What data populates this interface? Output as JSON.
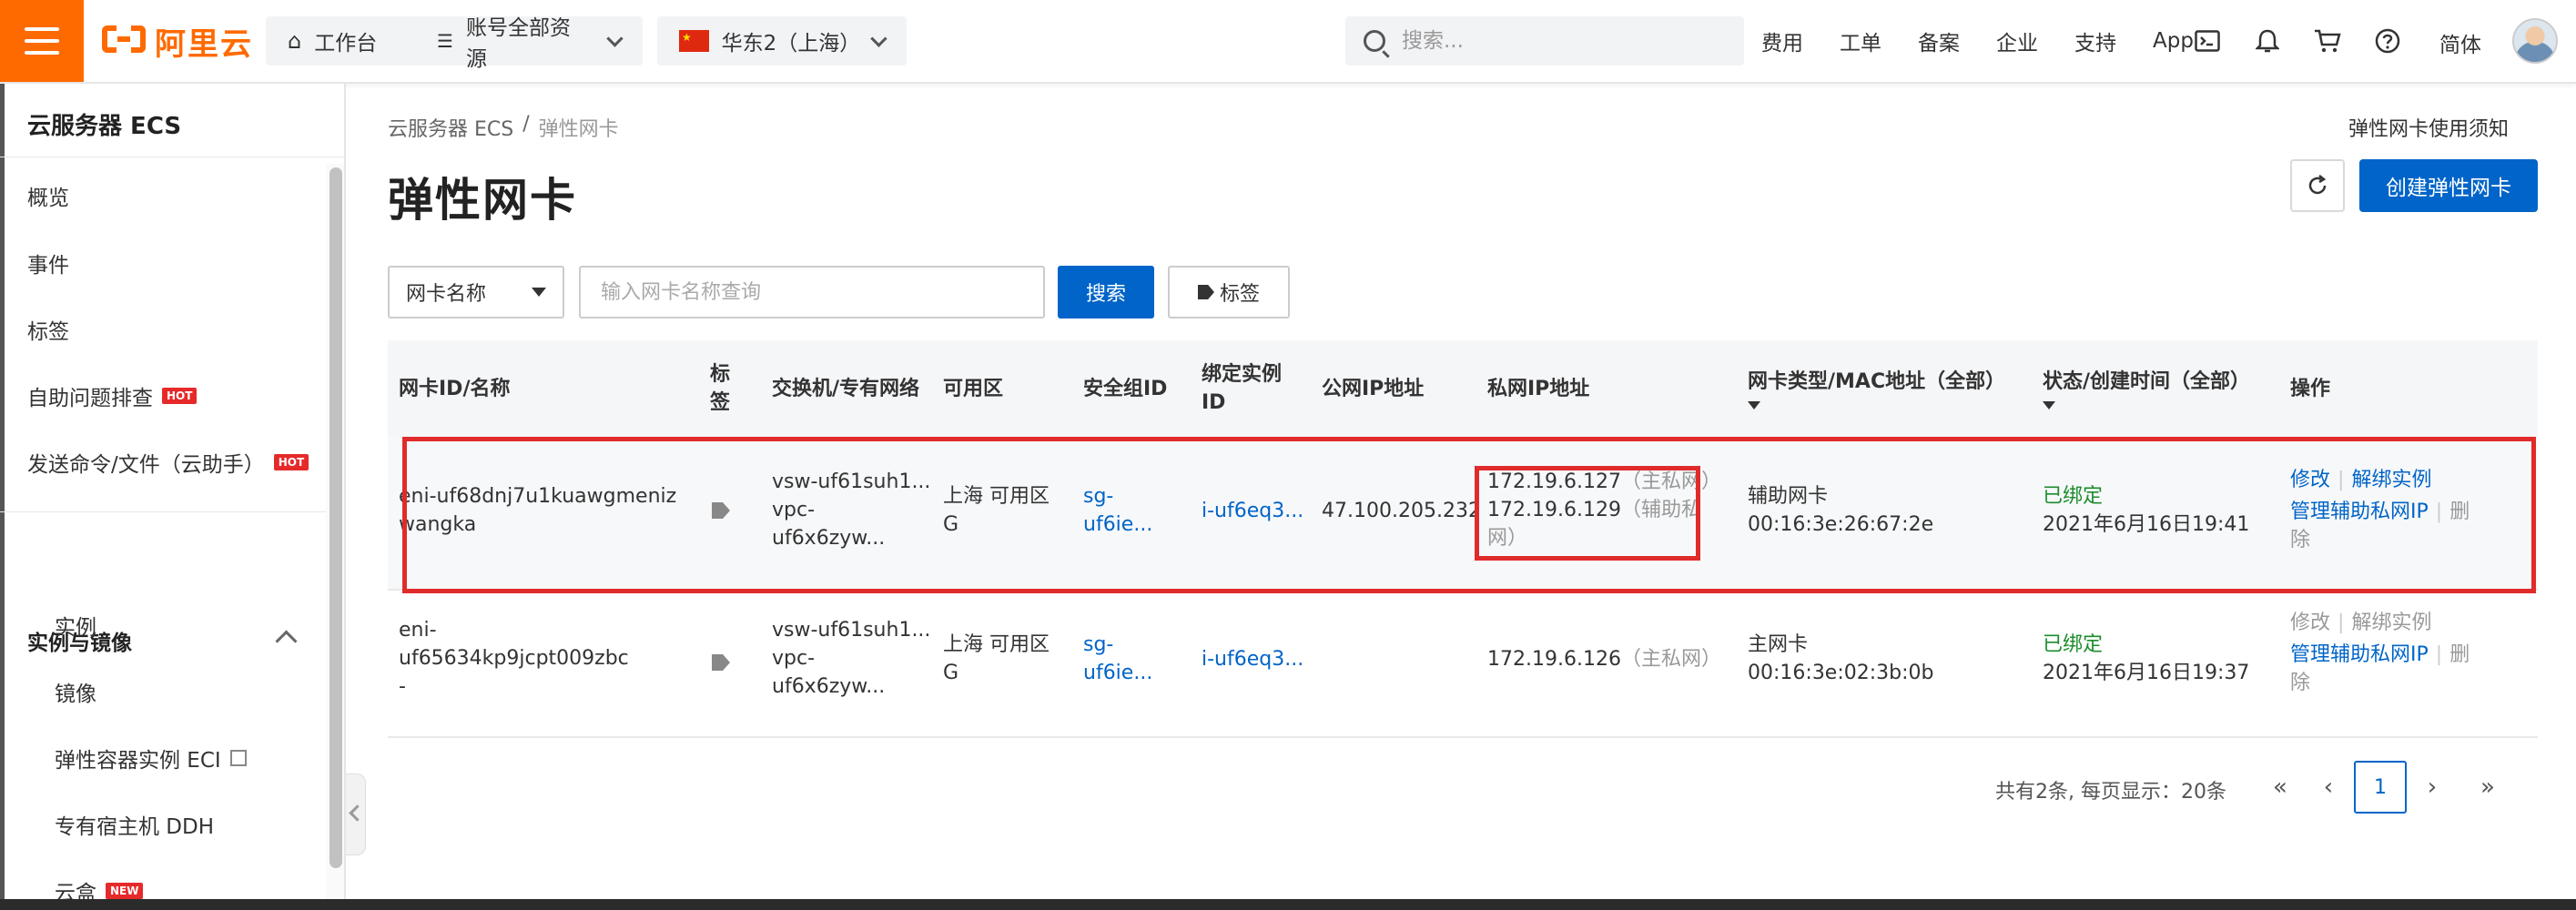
{
  "topbar": {
    "logo_text": "阿里云",
    "workbench": "工作台",
    "account_resources": "账号全部资源",
    "region": "华东2（上海）",
    "search_placeholder": "搜索...",
    "nav": [
      "费用",
      "工单",
      "备案",
      "企业",
      "支持",
      "App"
    ],
    "language": "简体"
  },
  "sidebar": {
    "title": "云服务器 ECS",
    "items": [
      {
        "label": "概览"
      },
      {
        "label": "事件"
      },
      {
        "label": "标签"
      },
      {
        "label": "自助问题排查",
        "badge": "HOT"
      },
      {
        "label": "发送命令/文件（云助手）",
        "badge": "HOT"
      }
    ],
    "group": "实例与镜像",
    "subitems": [
      {
        "label": "实例"
      },
      {
        "label": "镜像"
      },
      {
        "label": "弹性容器实例 ECI"
      },
      {
        "label": "专有宿主机 DDH"
      },
      {
        "label": "云盒",
        "badge": "NEW"
      }
    ]
  },
  "breadcrumb": [
    "云服务器 ECS",
    "/",
    "弹性网卡"
  ],
  "help_link": "弹性网卡使用须知",
  "page_title": "弹性网卡",
  "create_button": "创建弹性网卡",
  "filter": {
    "select_value": "网卡名称",
    "input_placeholder": "输入网卡名称查询",
    "search_label": "搜索",
    "tag_label": "标签"
  },
  "table": {
    "headers": {
      "id_name": "网卡ID/名称",
      "tag_l1": "标",
      "tag_l2": "签",
      "vswitch_vpc": "交换机/专有网络",
      "zone": "可用区",
      "security_group": "安全组ID",
      "bound_l1": "绑定实例",
      "bound_l2": "ID",
      "public_ip": "公网IP地址",
      "private_ip": "私网IP地址",
      "type_mac": "网卡类型/MAC地址（全部）",
      "status_time": "状态/创建时间（全部）",
      "actions": "操作"
    },
    "rows": [
      {
        "id_l1": "eni-uf68dnj7u1kuawgmeniz",
        "id_l2": "wangka",
        "vswitch": "vsw-uf61suh1...",
        "vpc_l1": "vpc-",
        "vpc_l2": "uf6x6zyw...",
        "zone_l1": "上海 可用区",
        "zone_l2": "G",
        "sg_l1": "sg-",
        "sg_l2": "uf6ie...",
        "instance": "i-uf6eq3...",
        "public_ip": "47.100.205.232",
        "ip1": "172.19.6.127",
        "ip1_tag": "（主私网）",
        "ip2": "172.19.6.129",
        "ip2_tag_l1": "（辅助私",
        "ip2_tag_l2": "网）",
        "nic_type": "辅助网卡",
        "mac": "00:16:3e:26:67:2e",
        "status": "已绑定",
        "created": "2021年6月16日19:41",
        "act_modify": "修改",
        "act_unbind": "解绑实例",
        "act_manage": "管理辅助私网IP",
        "act_delete_l1": "删",
        "act_delete_l2": "除"
      },
      {
        "id_l1": "eni-",
        "id_l2": "uf65634kp9jcpt009zbc",
        "id_l3": "-",
        "vswitch": "vsw-uf61suh1...",
        "vpc_l1": "vpc-",
        "vpc_l2": "uf6x6zyw...",
        "zone_l1": "上海 可用区",
        "zone_l2": "G",
        "sg_l1": "sg-",
        "sg_l2": "uf6ie...",
        "instance": "i-uf6eq3...",
        "ip1": "172.19.6.126",
        "ip1_tag": "（主私网）",
        "nic_type": "主网卡",
        "mac": "00:16:3e:02:3b:0b",
        "status": "已绑定",
        "created": "2021年6月16日19:37",
        "act_modify": "修改",
        "act_unbind": "解绑实例",
        "act_manage": "管理辅助私网IP",
        "act_delete_l1": "删",
        "act_delete_l2": "除"
      }
    ]
  },
  "pagination": {
    "summary": "共有2条, 每页显示：20条",
    "current_page": "1"
  }
}
